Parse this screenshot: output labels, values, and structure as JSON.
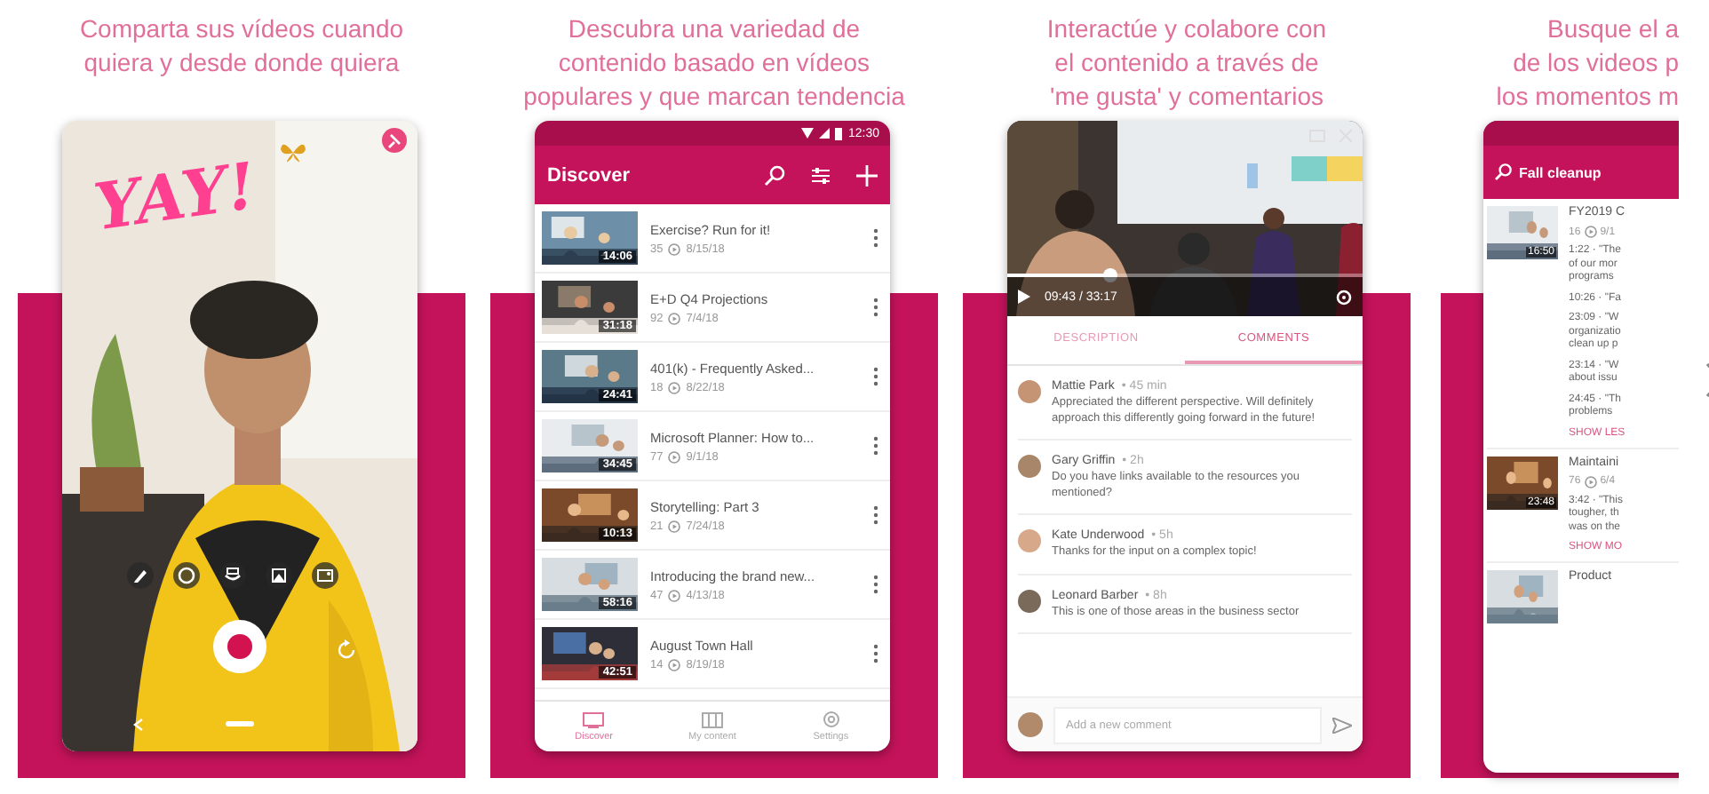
{
  "slides": [
    {
      "kind": "camera",
      "caption_lines": [
        "Comparta sus vídeos cuando",
        "quiera y desde donde quiera"
      ],
      "overlay_text": "YAY!"
    },
    {
      "kind": "discover",
      "caption_lines": [
        "Descubra una variedad de",
        "contenido basado en vídeos",
        "populares y que marcan tendencia"
      ],
      "status_time": "12:30",
      "title": "Discover",
      "videos": [
        {
          "title": "Exercise? Run for it!",
          "views": "35",
          "date": "8/15/18",
          "duration": "14:06"
        },
        {
          "title": "E+D Q4 Projections",
          "views": "92",
          "date": "7/4/18",
          "duration": "31:18"
        },
        {
          "title": "401(k) - Frequently Asked...",
          "views": "18",
          "date": "8/22/18",
          "duration": "24:41"
        },
        {
          "title": "Microsoft Planner: How to...",
          "views": "77",
          "date": "9/1/18",
          "duration": "34:45"
        },
        {
          "title": "Storytelling: Part 3",
          "views": "21",
          "date": "7/24/18",
          "duration": "10:13"
        },
        {
          "title": "Introducing the brand new...",
          "views": "47",
          "date": "4/13/18",
          "duration": "58:16"
        },
        {
          "title": "August Town Hall",
          "views": "14",
          "date": "8/19/18",
          "duration": "42:51"
        }
      ],
      "nav": [
        {
          "label": "Discover",
          "selected": true
        },
        {
          "label": "My content",
          "selected": false
        },
        {
          "label": "Settings",
          "selected": false
        }
      ]
    },
    {
      "kind": "player",
      "caption_lines": [
        "Interactúe y colabore con",
        "el contenido a través de",
        "'me gusta' y comentarios"
      ],
      "time": "09:43 / 33:17",
      "level": 0.29,
      "tabs": [
        {
          "label": "DESCRIPTION",
          "selected": false
        },
        {
          "label": "COMMENTS",
          "selected": true
        }
      ],
      "comments": [
        {
          "author": "Mattie Park",
          "time": "• 45 min",
          "text": "Appreciated the different perspective. Will definitely approach this differently going forward in the future!"
        },
        {
          "author": "Gary Griffin",
          "time": "• 2h",
          "text": "Do you have links available to the resources you mentioned?"
        },
        {
          "author": "Kate Underwood",
          "time": "• 5h",
          "text": "Thanks for the input on a complex topic!"
        },
        {
          "author": "Leonard Barber",
          "time": "• 8h",
          "text": "This is one of those areas in the business sector"
        }
      ],
      "placeholder": "Add a new comment"
    },
    {
      "kind": "search",
      "caption_lines": [
        "Busque el a",
        "de los videos p",
        "los momentos m"
      ],
      "query": "Fall cleanup",
      "results": [
        {
          "title": "FY2019 C",
          "views": "16",
          "date": "9/1",
          "duration": "16:50",
          "snippets": [
            [
              "1:22 · \"The",
              "of our mor",
              "programs"
            ],
            [
              "10:26 · \"Fa"
            ],
            [
              "23:09 · \"W",
              "organizatio",
              "clean up p"
            ],
            [
              "23:14 · \"W",
              "about issu"
            ],
            [
              "24:45 · \"Th",
              "problems"
            ]
          ],
          "toggle": "SHOW LES"
        },
        {
          "title": "Maintaini",
          "views": "76",
          "date": "6/4",
          "duration": "23:48",
          "snippets": [
            [
              "3:42 · \"This",
              "tougher, th",
              "was on the"
            ]
          ],
          "toggle": "SHOW MO"
        },
        {
          "title": "Product"
        }
      ]
    }
  ]
}
